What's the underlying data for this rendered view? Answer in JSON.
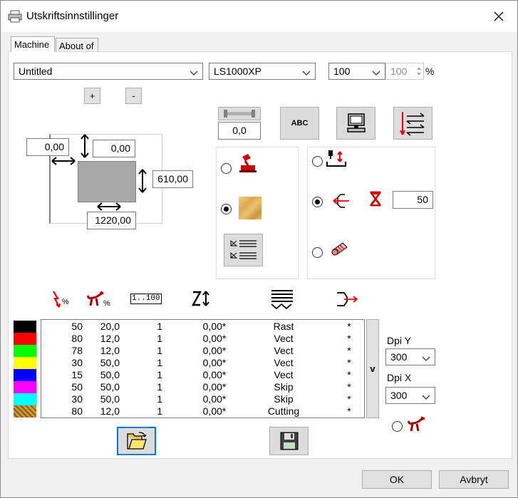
{
  "window": {
    "title": "Utskriftsinnstillinger"
  },
  "tabs": [
    {
      "label": "Machine"
    },
    {
      "label": "About of"
    }
  ],
  "top_controls": {
    "document_combo": "Untitled",
    "machine_combo": "LS1000XP",
    "scale_combo": "100",
    "scale_spinner": "100",
    "percent_symbol": "%"
  },
  "buttons": {
    "plus": "+",
    "minus": "-"
  },
  "page_dims": {
    "left_offset": "0,00",
    "top_offset": "0,00",
    "height": "610,00",
    "width": "1220,00"
  },
  "slider_value": "0,0",
  "abc_label": "ABC",
  "passes_value": "50",
  "column_icons": [
    "power-icon",
    "speed-icon",
    "passes-icon",
    "z-offset-icon",
    "mode-icon",
    "air-assist-icon"
  ],
  "passes_icon_text": "1..100",
  "layers": [
    {
      "color": "#000000",
      "power": "50",
      "speed": "20,0",
      "passes": "1",
      "z": "0,00*",
      "mode": "Rast",
      "air": "*"
    },
    {
      "color": "#ff0000",
      "power": "80",
      "speed": "12,0",
      "passes": "1",
      "z": "0,00*",
      "mode": "Vect",
      "air": "*"
    },
    {
      "color": "#00ff00",
      "power": "78",
      "speed": "12,0",
      "passes": "1",
      "z": "0,00*",
      "mode": "Vect",
      "air": "*"
    },
    {
      "color": "#ffff00",
      "power": "30",
      "speed": "50,0",
      "passes": "1",
      "z": "0,00*",
      "mode": "Vect",
      "air": "*"
    },
    {
      "color": "#0000ff",
      "power": "15",
      "speed": "50,0",
      "passes": "1",
      "z": "0,00*",
      "mode": "Vect",
      "air": "*"
    },
    {
      "color": "#ff00ff",
      "power": "50",
      "speed": "50,0",
      "passes": "1",
      "z": "0,00*",
      "mode": "Skip",
      "air": "*"
    },
    {
      "color": "#00ffff",
      "power": "30",
      "speed": "50,0",
      "passes": "1",
      "z": "0,00*",
      "mode": "Skip",
      "air": "*"
    },
    {
      "color": "#c89a3a",
      "power": "80",
      "speed": "12,0",
      "passes": "1",
      "z": "0,00*",
      "mode": "Cutting",
      "air": "*"
    }
  ],
  "sort_button": "v",
  "dpi": {
    "y_label": "Dpi Y",
    "y_value": "300",
    "x_label": "Dpi X",
    "x_value": "300"
  },
  "dialog": {
    "ok": "OK",
    "cancel": "Avbryt"
  }
}
